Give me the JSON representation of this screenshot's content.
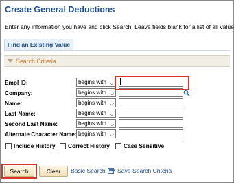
{
  "page": {
    "title": "Create General Deductions",
    "instructions": "Enter any information you have and click Search. Leave fields blank for a list of all values."
  },
  "tabs": [
    {
      "label": "Find an Existing Value"
    }
  ],
  "section": {
    "label": "Search Criteria"
  },
  "fields": [
    {
      "label": "Empl ID:",
      "operator": "begins with",
      "value": ""
    },
    {
      "label": "Company:",
      "operator": "begins with",
      "value": "",
      "has_lookup": true
    },
    {
      "label": "Name:",
      "operator": "begins with",
      "value": ""
    },
    {
      "label": "Last Name:",
      "operator": "begins with",
      "value": ""
    },
    {
      "label": "Second Last Name:",
      "operator": "begins with",
      "value": ""
    },
    {
      "label": "Alternate Character Name:",
      "operator": "begins with",
      "value": ""
    }
  ],
  "options": [
    {
      "label": "Include History",
      "checked": false
    },
    {
      "label": "Correct History",
      "checked": false
    },
    {
      "label": "Case Sensitive",
      "checked": false
    }
  ],
  "actions": {
    "search_label": "Search",
    "clear_label": "Clear",
    "basic_search_label": "Basic Search",
    "save_criteria_label": "Save Search Criteria"
  },
  "icons": {
    "dropdown": "chevron-down-icon",
    "lookup": "magnifier-icon",
    "save": "save-search-icon"
  },
  "colors": {
    "title": "#1c4f8c",
    "section_label": "#c47a2a",
    "highlight": "#d7342a"
  }
}
